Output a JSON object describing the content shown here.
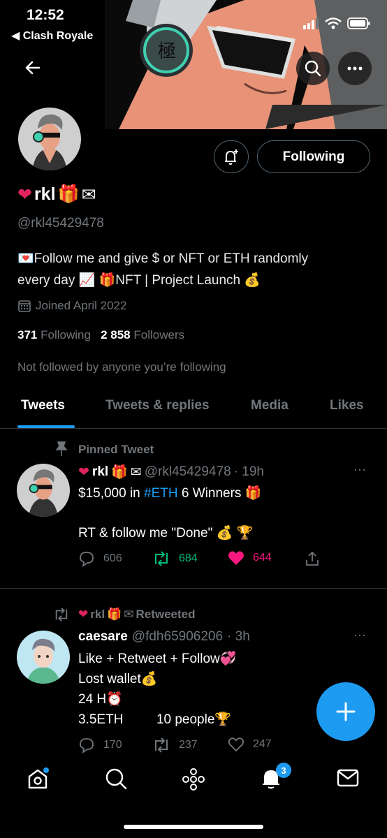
{
  "status_bar": {
    "time": "12:52",
    "back_app": "◀ Clash Royale"
  },
  "profile": {
    "name": "rkl",
    "handle": "@rkl45429478",
    "bio_line1": "Follow me and give $ or NFT or ETH randomly",
    "bio_line2_a": "every day",
    "bio_line2_b": "NFT | Project Launch",
    "joined": "Joined April 2022",
    "following_count": "371",
    "following_label": "Following",
    "followers_count": "2 858",
    "followers_label": "Followers",
    "not_followed": "Not followed by anyone you’re following",
    "follow_button": "Following"
  },
  "tabs": [
    "Tweets",
    "Tweets & replies",
    "Media",
    "Likes"
  ],
  "pinned_tweet": {
    "pinned_label": "Pinned Tweet",
    "author_name": "rkl",
    "author_handle": "@rkl45429478",
    "time": "· 19h",
    "text_a": "$15,000 in",
    "hashtag": "#ETH",
    "text_b": " 6  Winners",
    "text_line2": "RT  & follow me \"Done\"",
    "replies": "606",
    "retweets": "684",
    "likes": "644"
  },
  "retweet": {
    "retweeted_label": "Retweeted",
    "retweeter": "rkl",
    "author_name": "caesare",
    "author_handle": "@fdh65906206",
    "time": "· 3h",
    "line1": "Like + Retweet + Follow",
    "line2": " Lost wallet",
    "line3": "24 H",
    "line4a": "3.5ETH",
    "line4b": "10 people",
    "replies": "170",
    "retweets": "237",
    "likes": "247"
  },
  "notifications_badge": "3",
  "colors": {
    "accent": "#1d9bf0",
    "like": "#f91880",
    "retweet": "#00ba7c",
    "muted": "#71767b"
  }
}
